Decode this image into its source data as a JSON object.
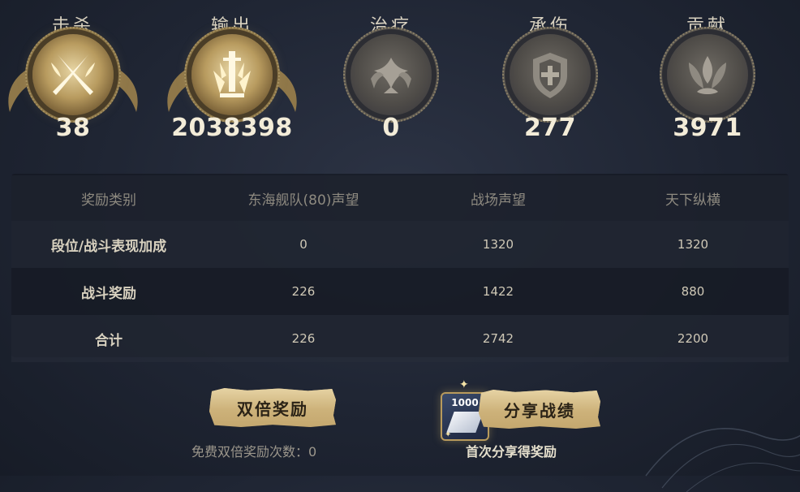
{
  "stats": [
    {
      "label": "击杀",
      "value": "38",
      "icon": "crossed-blades-icon",
      "active": true
    },
    {
      "label": "输出",
      "value": "2038398",
      "icon": "sword-burst-icon",
      "active": true
    },
    {
      "label": "治疗",
      "value": "0",
      "icon": "lotus-cross-icon",
      "active": false
    },
    {
      "label": "承伤",
      "value": "277",
      "icon": "shield-icon",
      "active": false
    },
    {
      "label": "贡献",
      "value": "3971",
      "icon": "flame-crest-icon",
      "active": false
    }
  ],
  "table": {
    "headers": [
      "奖励类别",
      "东海舰队(80)声望",
      "战场声望",
      "天下纵横"
    ],
    "rows": [
      {
        "label": "段位/战斗表现加成",
        "values": [
          "0",
          "1320",
          "1320"
        ]
      },
      {
        "label": "战斗奖励",
        "values": [
          "226",
          "1422",
          "880"
        ]
      },
      {
        "label": "合计",
        "values": [
          "226",
          "2742",
          "2200"
        ]
      }
    ]
  },
  "double_reward": {
    "button_label": "双倍奖励",
    "free_count_text": "免费双倍奖励次数：0"
  },
  "share": {
    "ticket_amount": "1000",
    "button_label": "分享战绩",
    "hint": "首次分享得奖励"
  },
  "colors": {
    "background": "#1f2533",
    "gold": "#c7ab72",
    "medal_active": "#b89b5f",
    "medal_inactive": "#4f4c48"
  }
}
